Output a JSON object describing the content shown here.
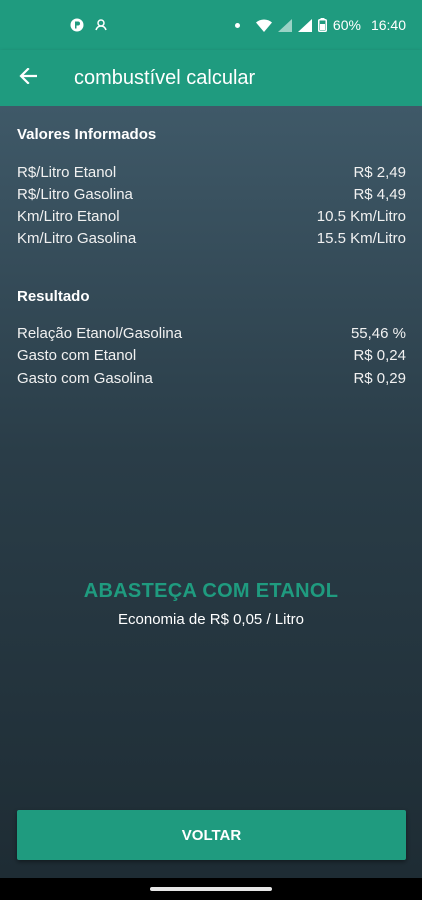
{
  "status_bar": {
    "battery": "60%",
    "time": "16:40",
    "network": "4G"
  },
  "appbar": {
    "title": "combustível calcular",
    "back_icon": "arrow-back-icon"
  },
  "informed": {
    "title": "Valores Informados",
    "rows": [
      {
        "label": "R$/Litro Etanol",
        "value": "R$ 2,49"
      },
      {
        "label": "R$/Litro Gasolina",
        "value": "R$ 4,49"
      },
      {
        "label": "Km/Litro Etanol",
        "value": "10.5 Km/Litro"
      },
      {
        "label": "Km/Litro Gasolina",
        "value": "15.5 Km/Litro"
      }
    ]
  },
  "result": {
    "title": "Resultado",
    "rows": [
      {
        "label": "Relação Etanol/Gasolina",
        "value": "55,46 %"
      },
      {
        "label": "Gasto com Etanol",
        "value": "R$ 0,24"
      },
      {
        "label": "Gasto com Gasolina",
        "value": "R$ 0,29"
      }
    ]
  },
  "verdict": {
    "headline": "ABASTEÇA COM ETANOL",
    "economy": "Economia de R$ 0,05 / Litro"
  },
  "actions": {
    "back_label": "VOLTAR"
  },
  "colors": {
    "accent": "#1f9b7f"
  }
}
